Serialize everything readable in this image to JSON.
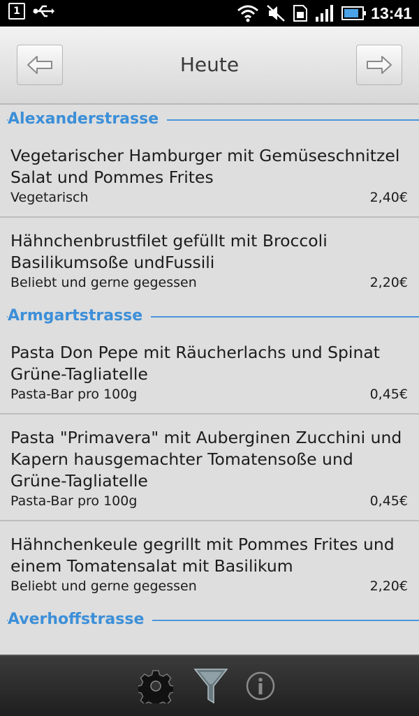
{
  "status_bar": {
    "time": "13:41",
    "calendar_day": "1",
    "icons": [
      "calendar-icon",
      "usb-icon",
      "wifi-icon",
      "muted-icon",
      "sim-icon",
      "signal-icon",
      "battery-icon"
    ]
  },
  "header": {
    "title": "Heute",
    "prev_icon": "arrow-left-icon",
    "next_icon": "arrow-right-icon"
  },
  "sections": [
    {
      "name": "Alexanderstrasse",
      "items": [
        {
          "title": "Vegetarischer Hamburger mit Gemüseschnitzel Salat und Pommes Frites",
          "category": "Vegetarisch",
          "price": "2,40€"
        },
        {
          "title": "Hähnchenbrustfilet gefüllt mit Broccoli Basilikumsoße undFussili",
          "category": "Beliebt und gerne gegessen",
          "price": "2,20€"
        }
      ]
    },
    {
      "name": "Armgartstrasse",
      "items": [
        {
          "title": "Pasta Don Pepe mit Räucherlachs und Spinat Grüne-Tagliatelle",
          "category": "Pasta-Bar pro 100g",
          "price": "0,45€"
        },
        {
          "title": "Pasta \"Primavera\" mit Auberginen Zucchini und Kapern hausgemachter Tomatensoße und Grüne-Tagliatelle",
          "category": "Pasta-Bar pro 100g",
          "price": "0,45€"
        },
        {
          "title": "Hähnchenkeule gegrillt mit Pommes Frites und einem Tomatensalat mit Basilikum",
          "category": "Beliebt und gerne gegessen",
          "price": "2,20€"
        }
      ]
    },
    {
      "name": "Averhoffstrasse",
      "items": []
    }
  ],
  "bottom_bar": {
    "icons": [
      "settings-gear-icon",
      "filter-funnel-icon",
      "info-icon"
    ]
  },
  "colors": {
    "accent": "#3c8fd8",
    "background": "#dedede",
    "divider": "#bdbdbd"
  }
}
